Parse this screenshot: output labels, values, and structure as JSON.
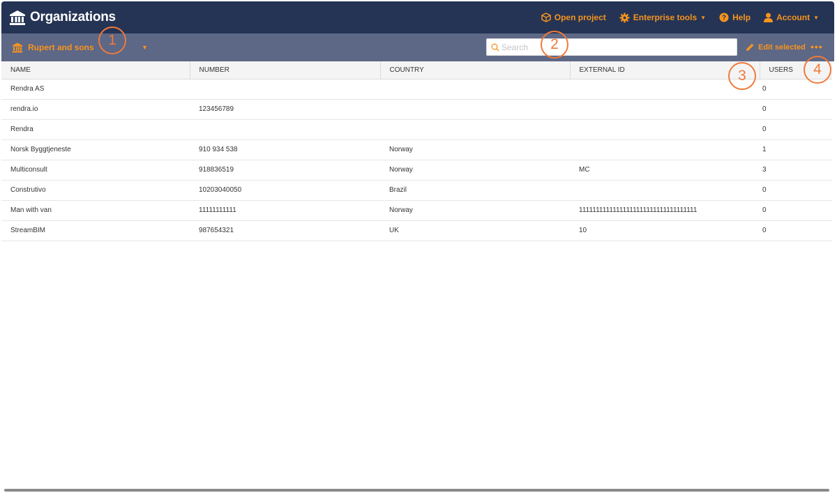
{
  "header": {
    "title": "Organizations",
    "nav": {
      "open_project": "Open project",
      "enterprise_tools": "Enterprise tools",
      "help": "Help",
      "account": "Account"
    }
  },
  "toolbar": {
    "organization": "Rupert and sons",
    "search_placeholder": "Search",
    "edit_selected": "Edit selected",
    "more": "•••"
  },
  "table": {
    "columns": [
      "NAME",
      "NUMBER",
      "COUNTRY",
      "EXTERNAL ID",
      "USERS"
    ],
    "rows": [
      [
        "Rendra AS",
        "",
        "",
        "",
        "0"
      ],
      [
        "rendra.io",
        "123456789",
        "",
        "",
        "0"
      ],
      [
        "Rendra",
        "",
        "",
        "",
        "0"
      ],
      [
        "Norsk Byggtjeneste",
        "910 934 538",
        "Norway",
        "",
        "1"
      ],
      [
        "Multiconsult",
        "918836519",
        "Norway",
        "MC",
        "3"
      ],
      [
        "Construtivo",
        "10203040050",
        "Brazil",
        "",
        "0"
      ],
      [
        "Man with van",
        "11111111111",
        "Norway",
        "11111111111111111111111111111111111",
        "0"
      ],
      [
        "StreamBIM",
        "987654321",
        "UK",
        "10",
        "0"
      ]
    ]
  },
  "callouts": [
    "1",
    "2",
    "3",
    "4"
  ],
  "colors": {
    "header_bg": "#253454",
    "toolbar_bg": "#5d6786",
    "accent": "#f7941d",
    "callout": "#f07a3a"
  },
  "icons": {
    "brand": "institution-icon",
    "open_project": "cube-icon",
    "enterprise_tools": "gear-icon",
    "help": "question-circle-icon",
    "account": "user-icon",
    "organization": "institution-icon",
    "search": "search-icon",
    "edit": "pencil-icon"
  }
}
